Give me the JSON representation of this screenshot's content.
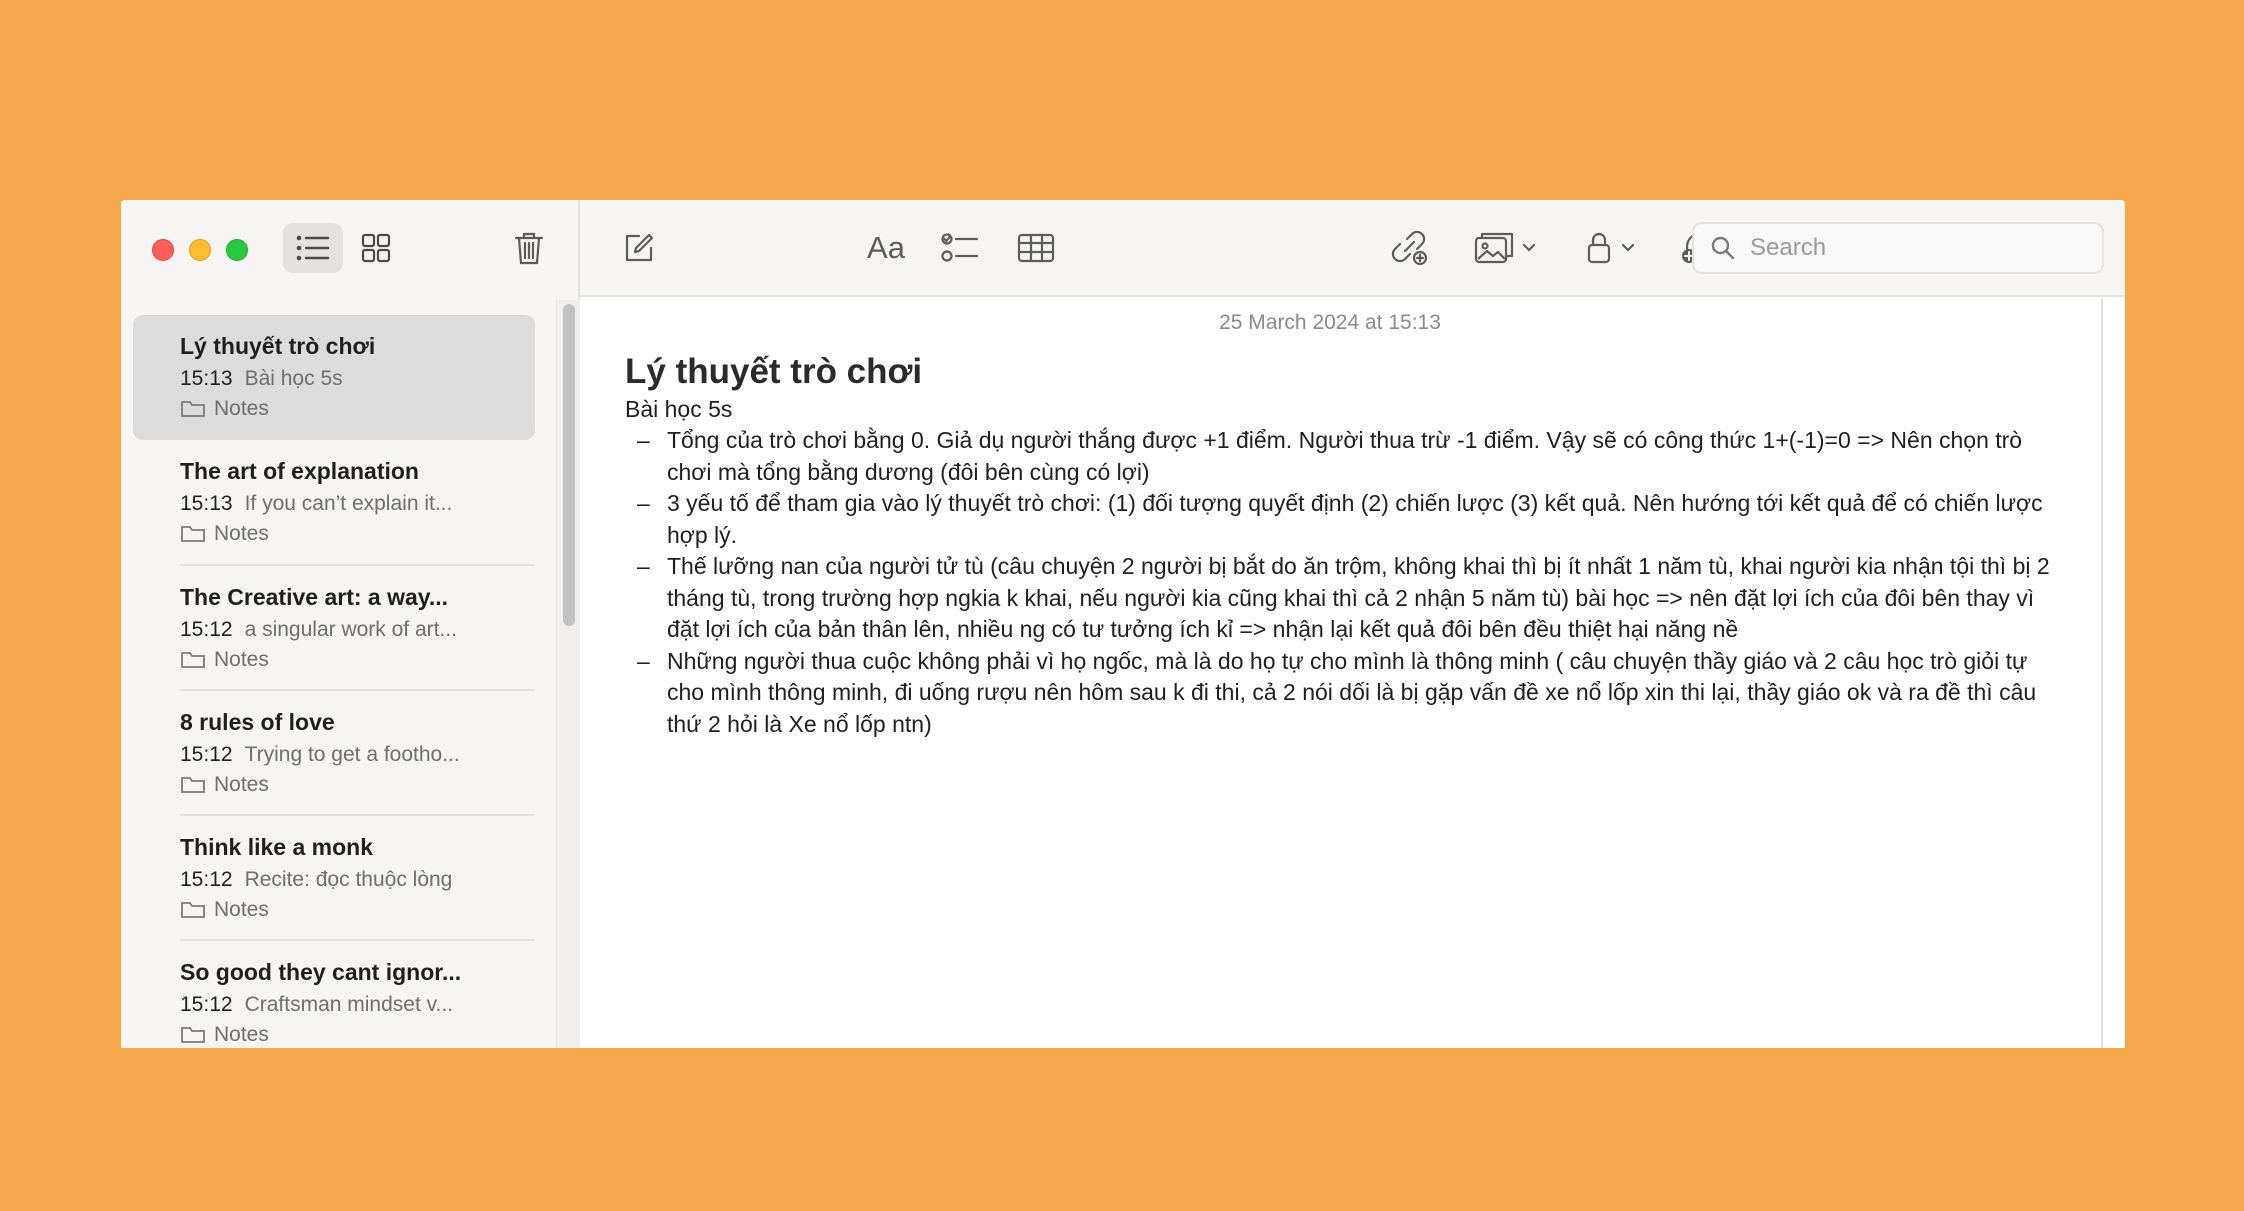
{
  "sidebar": {
    "notes": [
      {
        "title": "Lý thuyết trò chơi",
        "time": "15:13",
        "preview": "Bài học 5s",
        "folder": "Notes"
      },
      {
        "title": "The art of explanation",
        "time": "15:13",
        "preview": "If you can’t explain it...",
        "folder": "Notes"
      },
      {
        "title": "The Creative art: a way...",
        "time": "15:12",
        "preview": "a singular work of art...",
        "folder": "Notes"
      },
      {
        "title": "8 rules of love",
        "time": "15:12",
        "preview": "Trying to get a footho...",
        "folder": "Notes"
      },
      {
        "title": "Think like a monk",
        "time": "15:12",
        "preview": "Recite: đọc thuộc lòng",
        "folder": "Notes"
      },
      {
        "title": "So good they cant ignor...",
        "time": "15:12",
        "preview": "Craftsman mindset v...",
        "folder": "Notes"
      }
    ],
    "selected_index": 0
  },
  "toolbar": {
    "format_label": "Aa",
    "search_placeholder": "Search"
  },
  "note": {
    "date": "25 March 2024 at 15:13",
    "title": "Lý thuyết trò chơi",
    "subtitle": "Bài học 5s",
    "bullets": [
      "Tổng của trò chơi bằng 0. Giả dụ người thắng được +1 điểm. Người thua trừ -1 điểm. Vậy sẽ có công thức 1+(-1)=0 => Nên chọn trò chơi mà tổng bằng dương (đôi bên cùng có lợi)",
      "3 yếu tố để tham gia vào lý thuyết trò chơi: (1) đối tượng quyết định (2) chiến lược (3) kết quả. Nên hướng tới kết quả để có chiến lược hợp lý.",
      "Thế lưỡng nan của người tử tù (câu chuyện 2 người bị bắt do ăn trộm, không khai thì bị ít nhất 1 năm tù, khai người kia nhận tội thì bị 2 tháng tù, trong trường hợp ngkia k khai, nếu người kia cũng khai thì cả 2 nhận 5 năm tù) bài học => nên đặt lợi ích của đôi bên thay vì đặt lợi ích của bản thân lên, nhiều ng có tư tưởng ích kỉ => nhận lại kết quả đôi bên đều thiệt hại năng nề",
      "Những người thua cuộc không phải vì họ ngốc, mà là do họ tự cho mình là thông minh ( câu chuyện thầy giáo và 2 câu học trò giỏi tự cho mình thông minh, đi uống rượu nên hôm sau k đi thi, cả 2 nói dối là bị gặp vấn đề xe nổ lốp xin thi lại, thầy giáo ok và ra đề thì câu thứ 2 hỏi là Xe nổ lốp ntn)"
    ]
  },
  "colors": {
    "background": "#F6A94C",
    "close": "#FF5F57",
    "minimize": "#FEBC2E",
    "zoom": "#28C840",
    "selection": "#DCDCDC"
  },
  "icons": [
    "list-view-icon",
    "gallery-view-icon",
    "trash-icon",
    "compose-icon",
    "checklist-icon",
    "table-icon",
    "collaborate-icon",
    "media-icon",
    "lock-icon",
    "share-link-icon",
    "share-icon",
    "search-icon",
    "folder-icon"
  ]
}
